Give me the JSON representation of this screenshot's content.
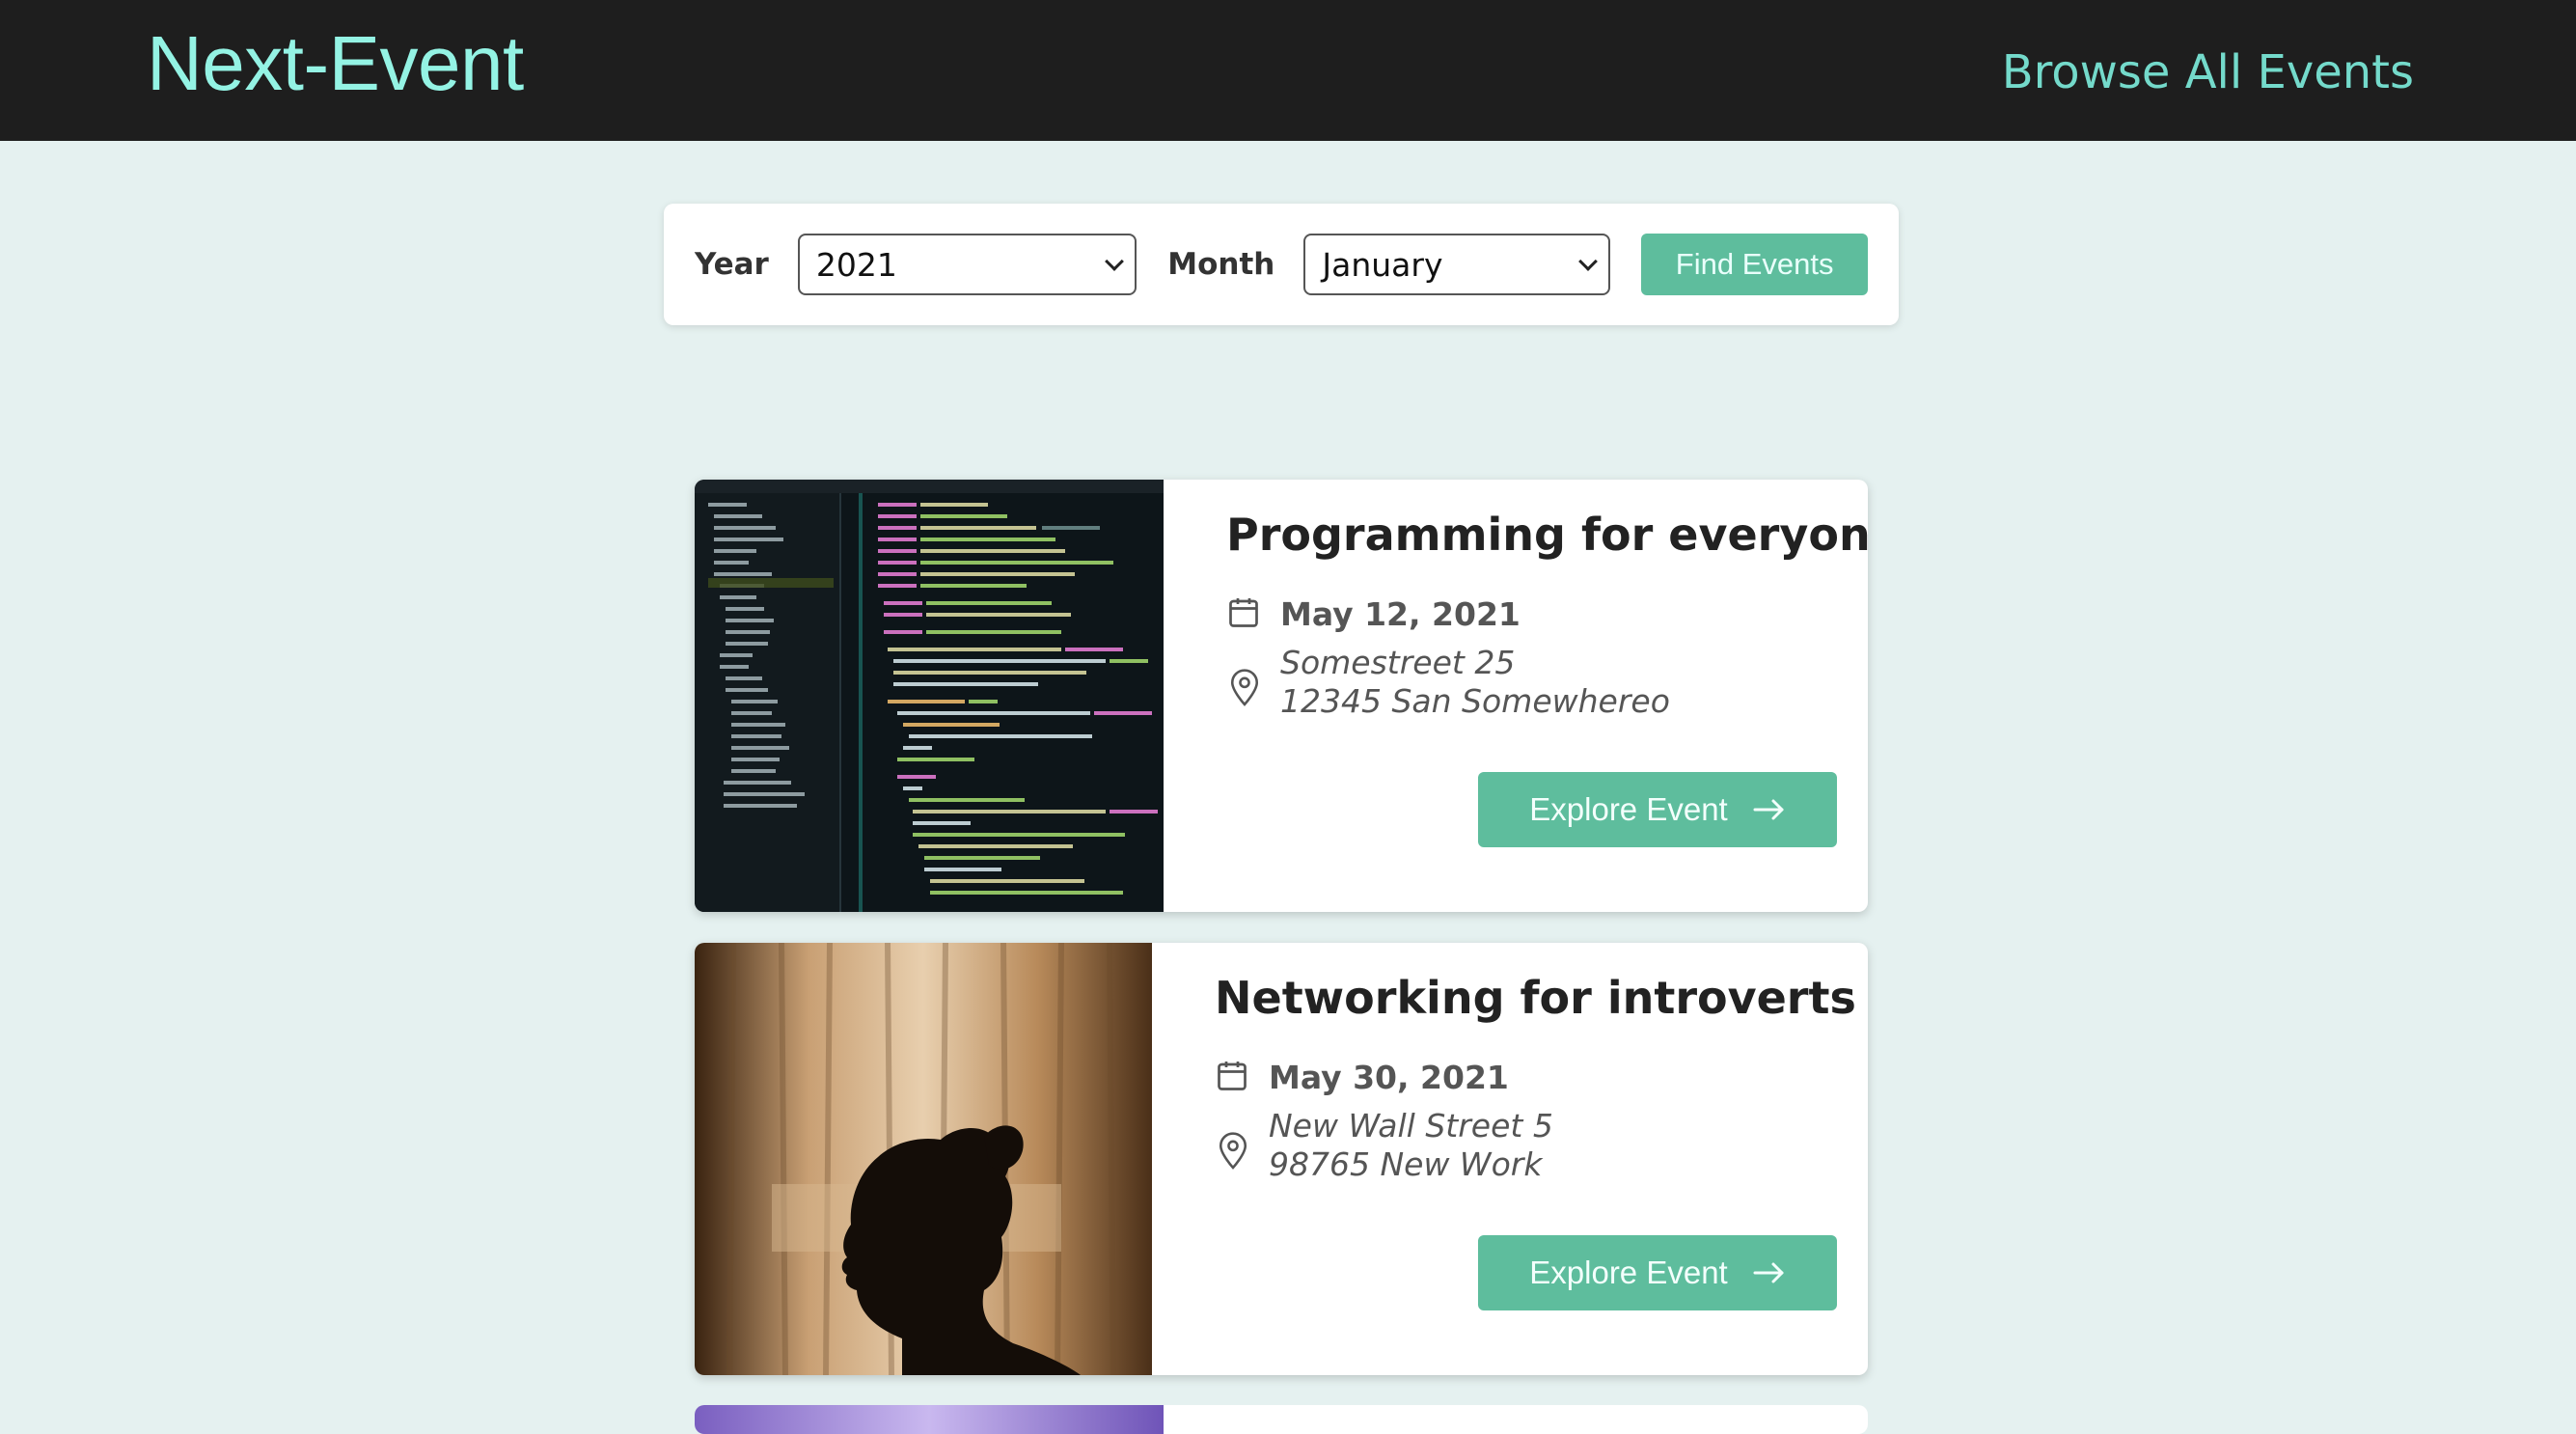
{
  "header": {
    "logo": "Next-Event",
    "nav_link": "Browse All Events"
  },
  "filter": {
    "year_label": "Year",
    "year_value": "2021",
    "month_label": "Month",
    "month_value": "January",
    "find_button": "Find Events"
  },
  "events": [
    {
      "title": "Programming for everyone",
      "date": "May 12, 2021",
      "address_line1": "Somestreet 25",
      "address_line2": "12345 San Somewhereo",
      "button": "Explore Event",
      "image": "code-editor-screenshot"
    },
    {
      "title": "Networking for introverts",
      "date": "May 30, 2021",
      "address_line1": "New Wall Street 5",
      "address_line2": "98765 New Work",
      "button": "Explore Event",
      "image": "woman-silhouette-by-window"
    }
  ],
  "colors": {
    "header_bg": "#1e1e1e",
    "page_bg": "#e5f1f0",
    "accent": "#5ebd9d",
    "logo": "#94f3e4"
  }
}
